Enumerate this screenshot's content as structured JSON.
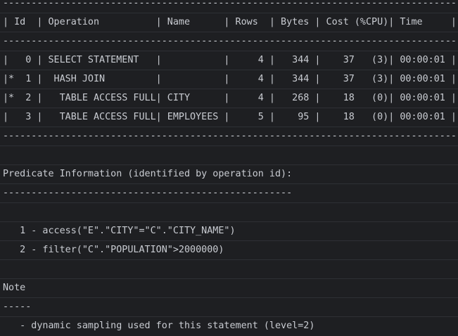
{
  "output": {
    "lines": [
      "--------------------------------------------------------------------------------",
      "| Id  | Operation          | Name      | Rows  | Bytes | Cost (%CPU)| Time     |",
      "--------------------------------------------------------------------------------",
      "|   0 | SELECT STATEMENT   |           |     4 |   344 |    37   (3)| 00:00:01 |",
      "|*  1 |  HASH JOIN         |           |     4 |   344 |    37   (3)| 00:00:01 |",
      "|*  2 |   TABLE ACCESS FULL| CITY      |     4 |   268 |    18   (0)| 00:00:01 |",
      "|   3 |   TABLE ACCESS FULL| EMPLOYEES |     5 |    95 |    18   (0)| 00:00:01 |",
      "--------------------------------------------------------------------------------",
      "",
      "Predicate Information (identified by operation id):",
      "---------------------------------------------------",
      "",
      "   1 - access(\"E\".\"CITY\"=\"C\".\"CITY_NAME\")",
      "   2 - filter(\"C\".\"POPULATION\">2000000)",
      "",
      "Note",
      "-----",
      "   - dynamic sampling used for this statement (level=2)"
    ]
  }
}
